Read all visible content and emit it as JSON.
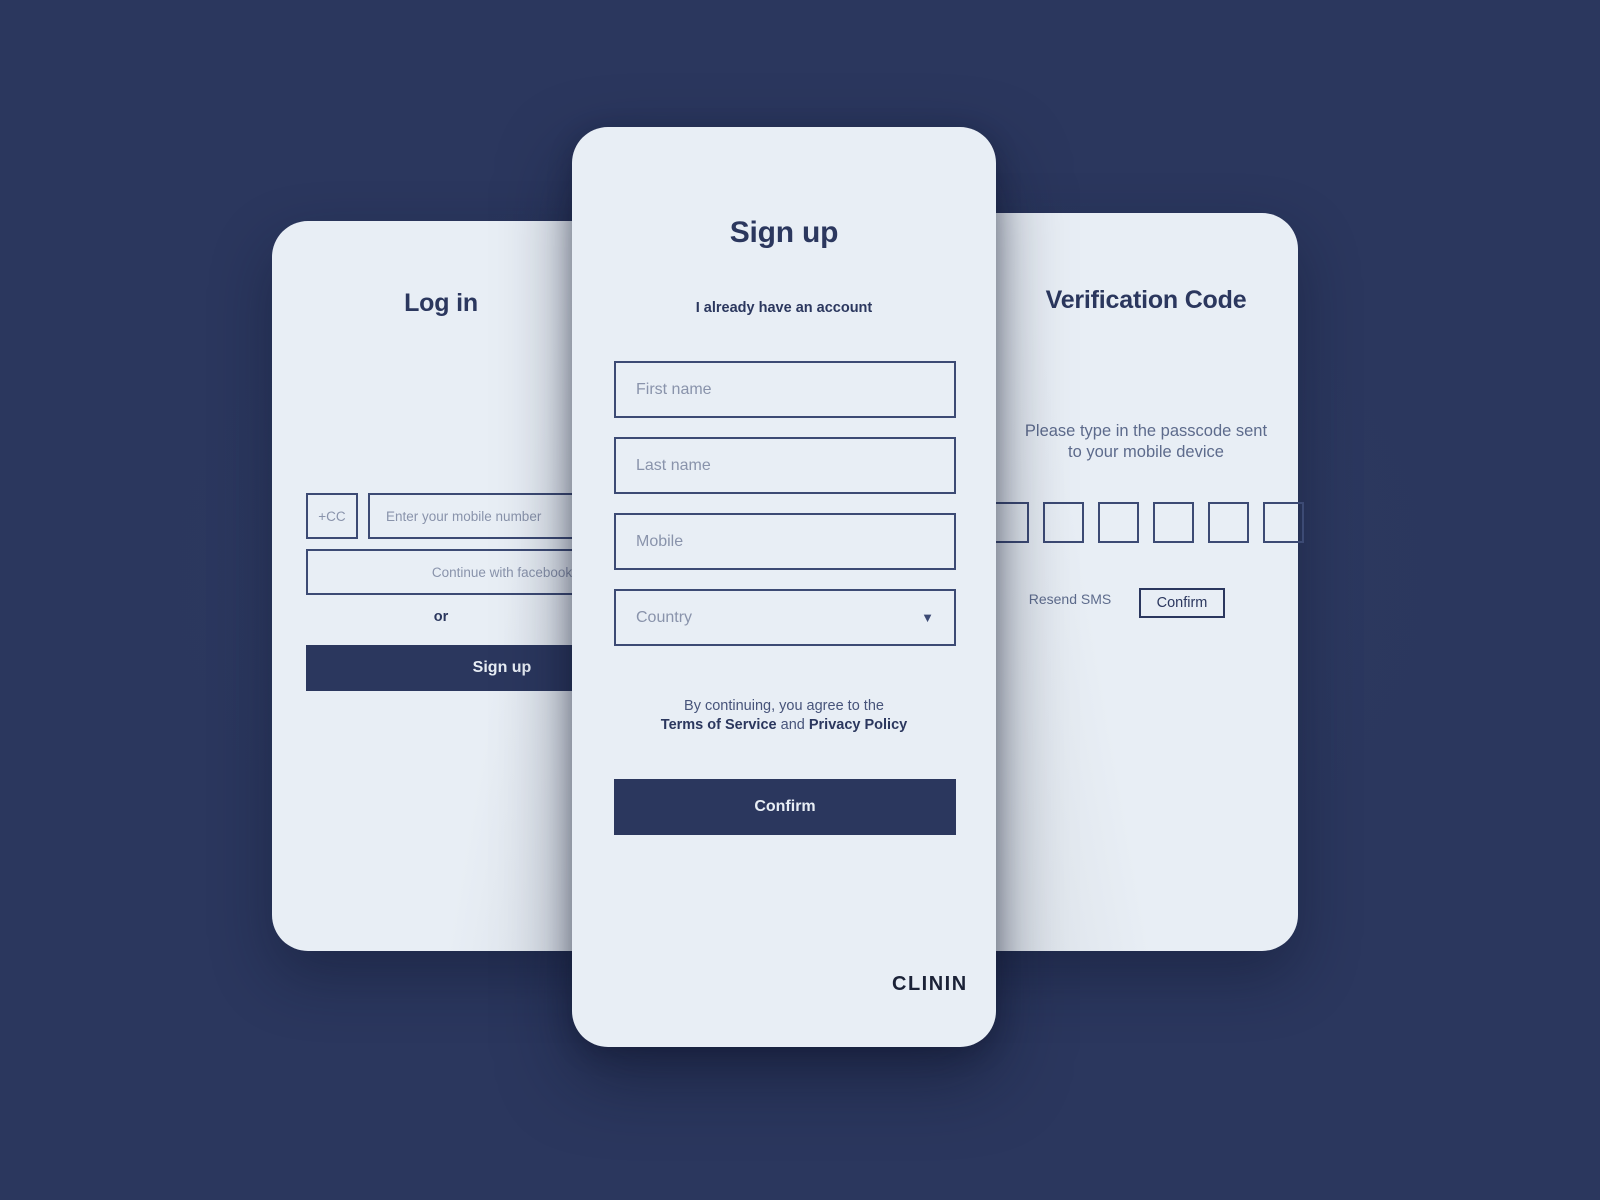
{
  "theme": {
    "background": "#2b375e",
    "card_background": "#e8eef5",
    "accent": "#2b375e",
    "border": "#3c4a74",
    "placeholder": "#8993ab",
    "muted_text": "#5d6b8c"
  },
  "login_screen": {
    "title": "Log in",
    "country_code_placeholder": "+CC",
    "mobile_placeholder": "Enter your mobile number",
    "facebook_button": "Continue with facebook",
    "divider": "or",
    "signup_button": "Sign up"
  },
  "signup_screen": {
    "title": "Sign up",
    "subtitle": "I already have an account",
    "fields": [
      {
        "name": "first-name",
        "placeholder": "First name"
      },
      {
        "name": "last-name",
        "placeholder": "Last name"
      },
      {
        "name": "mobile",
        "placeholder": "Mobile"
      },
      {
        "name": "country",
        "placeholder": "Country"
      }
    ],
    "country_caret_icon": "chevron-down-icon",
    "terms": {
      "line1": "By continuing, you agree to the",
      "terms_link": "Terms of Service",
      "conjunction": "and",
      "privacy_link": "Privacy Policy"
    },
    "confirm_button": "Confirm",
    "logo": "CLININ"
  },
  "verification_screen": {
    "title": "Verification Code",
    "instructions_line1": "Please type in the passcode sent",
    "instructions_line2": "to your mobile device",
    "code_boxes": [
      "",
      "",
      "",
      "",
      "",
      ""
    ],
    "resend_label": "Resend SMS",
    "confirm_button": "Confirm"
  }
}
